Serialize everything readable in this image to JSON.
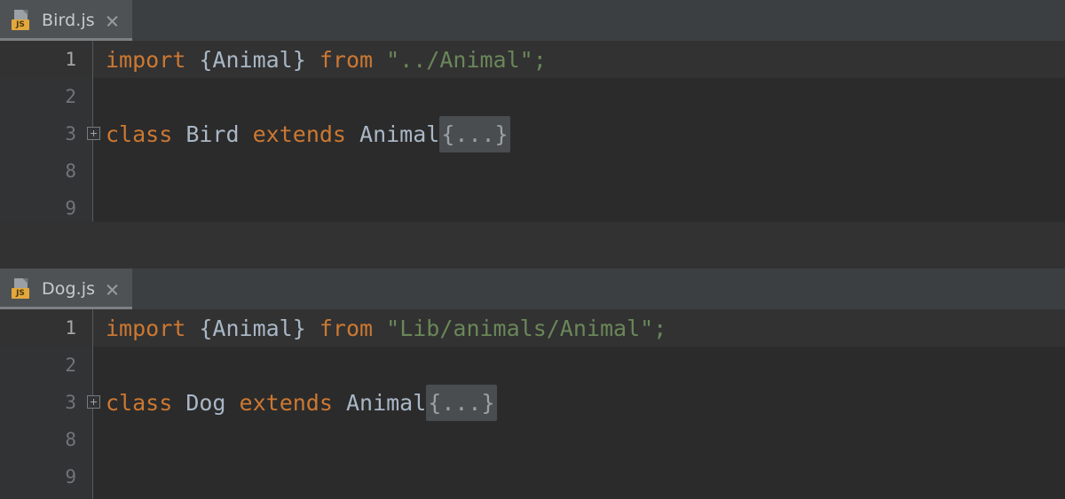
{
  "editor_theme": {
    "background": "#2b2b2b",
    "gutter_background": "#313335",
    "current_line_background": "#323232",
    "tabbar_background": "#3c3f41",
    "active_tab_background": "#4e5254",
    "keyword_color": "#cc7832",
    "identifier_color": "#a9b7c6",
    "string_color": "#6a8759",
    "fold_placeholder_background": "#4a4d50",
    "js_badge_color": "#e3a83c"
  },
  "panes": [
    {
      "tab": {
        "label": "Bird.js",
        "icon": "javascript-file-icon",
        "badge": "JS",
        "close_icon": "close-icon",
        "active": true
      },
      "line_numbers": [
        "1",
        "2",
        "3",
        "8",
        "9"
      ],
      "current_line_index": 0,
      "lines": [
        {
          "number": "1",
          "folded": false,
          "tokens": [
            {
              "text": "import",
              "type": "keyword"
            },
            {
              "text": " ",
              "type": "plain"
            },
            {
              "text": "{Animal}",
              "type": "identifier"
            },
            {
              "text": " ",
              "type": "plain"
            },
            {
              "text": "from",
              "type": "keyword"
            },
            {
              "text": " ",
              "type": "plain"
            },
            {
              "text": "\"../Animal\";",
              "type": "string"
            }
          ]
        },
        {
          "number": "2",
          "folded": false,
          "tokens": []
        },
        {
          "number": "3",
          "folded": true,
          "fold_marker": "expand-fold-icon",
          "tokens": [
            {
              "text": "class",
              "type": "keyword"
            },
            {
              "text": " ",
              "type": "plain"
            },
            {
              "text": "Bird",
              "type": "identifier"
            },
            {
              "text": " ",
              "type": "plain"
            },
            {
              "text": "extends",
              "type": "keyword"
            },
            {
              "text": " ",
              "type": "plain"
            },
            {
              "text": "Animal",
              "type": "identifier"
            },
            {
              "text": "{...}",
              "type": "fold-placeholder"
            }
          ]
        },
        {
          "number": "8",
          "folded": false,
          "tokens": []
        },
        {
          "number": "9",
          "folded": false,
          "tokens": []
        }
      ]
    },
    {
      "tab": {
        "label": "Dog.js",
        "icon": "javascript-file-icon",
        "badge": "JS",
        "close_icon": "close-icon",
        "active": true
      },
      "line_numbers": [
        "1",
        "2",
        "3",
        "8",
        "9"
      ],
      "current_line_index": 0,
      "lines": [
        {
          "number": "1",
          "folded": false,
          "tokens": [
            {
              "text": "import",
              "type": "keyword"
            },
            {
              "text": " ",
              "type": "plain"
            },
            {
              "text": "{Animal}",
              "type": "identifier"
            },
            {
              "text": " ",
              "type": "plain"
            },
            {
              "text": "from",
              "type": "keyword"
            },
            {
              "text": " ",
              "type": "plain"
            },
            {
              "text": "\"Lib/animals/Animal\";",
              "type": "string"
            }
          ]
        },
        {
          "number": "2",
          "folded": false,
          "tokens": []
        },
        {
          "number": "3",
          "folded": true,
          "fold_marker": "expand-fold-icon",
          "tokens": [
            {
              "text": "class",
              "type": "keyword"
            },
            {
              "text": " ",
              "type": "plain"
            },
            {
              "text": "Dog",
              "type": "identifier"
            },
            {
              "text": " ",
              "type": "plain"
            },
            {
              "text": "extends",
              "type": "keyword"
            },
            {
              "text": " ",
              "type": "plain"
            },
            {
              "text": "Animal",
              "type": "identifier"
            },
            {
              "text": "{...}",
              "type": "fold-placeholder"
            }
          ]
        },
        {
          "number": "8",
          "folded": false,
          "tokens": []
        },
        {
          "number": "9",
          "folded": false,
          "tokens": []
        }
      ]
    }
  ]
}
